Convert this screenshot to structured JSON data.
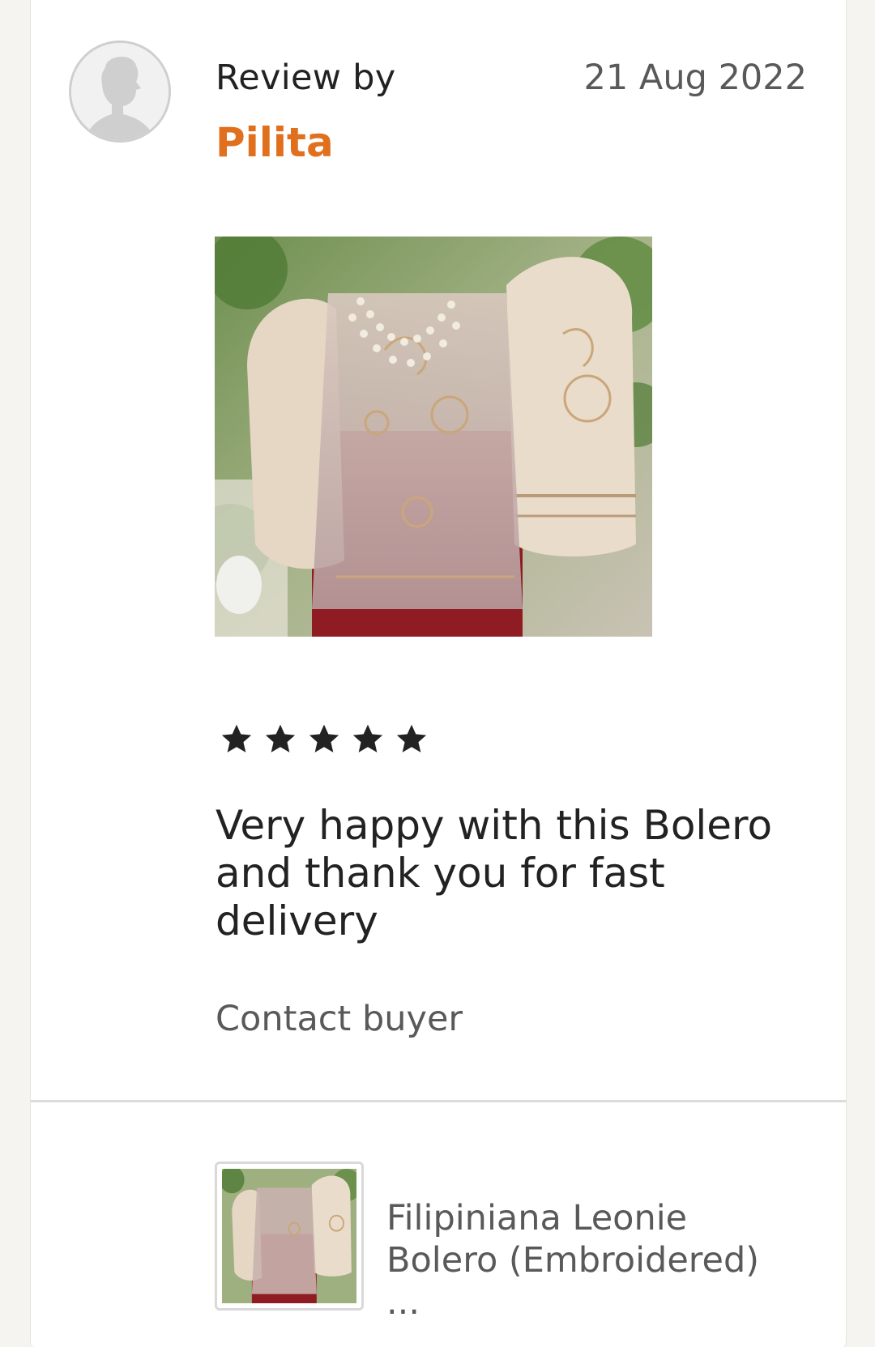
{
  "review": {
    "heading": "Review by",
    "reviewer_name": "Pilita",
    "date": "21 Aug 2022",
    "photo_alt": "Embroidered bolero on mannequin",
    "rating": 5,
    "rating_max": 5,
    "text": "Very happy with this Bolero and thank you for fast delivery",
    "contact_label": "Contact buyer"
  },
  "listing": {
    "title": "Filipiniana Leonie Bolero (Embroidered) ..."
  },
  "colors": {
    "accent_orange": "#e0701e",
    "text_primary": "#222222",
    "text_secondary": "#595959",
    "divider": "#dcdcdc",
    "page_bg": "#f5f4f1"
  },
  "icons": {
    "avatar": "default-user-avatar-icon",
    "star": "star-filled-icon"
  }
}
